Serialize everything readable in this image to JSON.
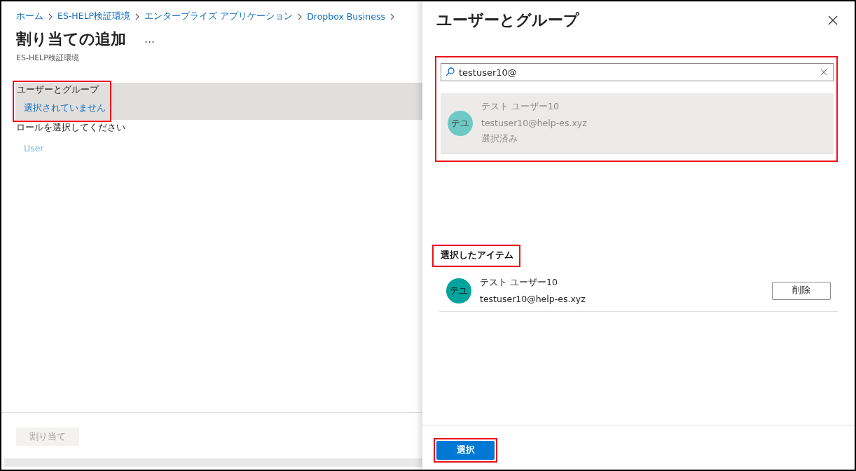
{
  "breadcrumb": [
    "ホーム",
    "ES-HELP検証環境",
    "エンタープライズ アプリケーション",
    "Dropbox Business"
  ],
  "page": {
    "title": "割り当ての追加",
    "more": "…",
    "subtitle": "ES-HELP検証環境"
  },
  "users_groups": {
    "label": "ユーザーとグループ",
    "value": "選択されていません",
    "highlighted": true
  },
  "role": {
    "label": "ロールを選択してください",
    "value": "User"
  },
  "assign_button": {
    "label": "割り当て",
    "disabled": true
  },
  "panel": {
    "title": "ユーザーとグループ",
    "search": {
      "value": "testuser10@"
    },
    "results": [
      {
        "initials": "テユ",
        "name": "テスト ユーザー10",
        "email": "testuser10@help-es.xyz",
        "status": "選択済み",
        "selected": true
      }
    ],
    "selected_heading": "選択したアイテム",
    "selected_items": [
      {
        "initials": "テユ",
        "name": "テスト ユーザー10",
        "email": "testuser10@help-es.xyz",
        "remove": "削除"
      }
    ],
    "select_button": "選択"
  }
}
